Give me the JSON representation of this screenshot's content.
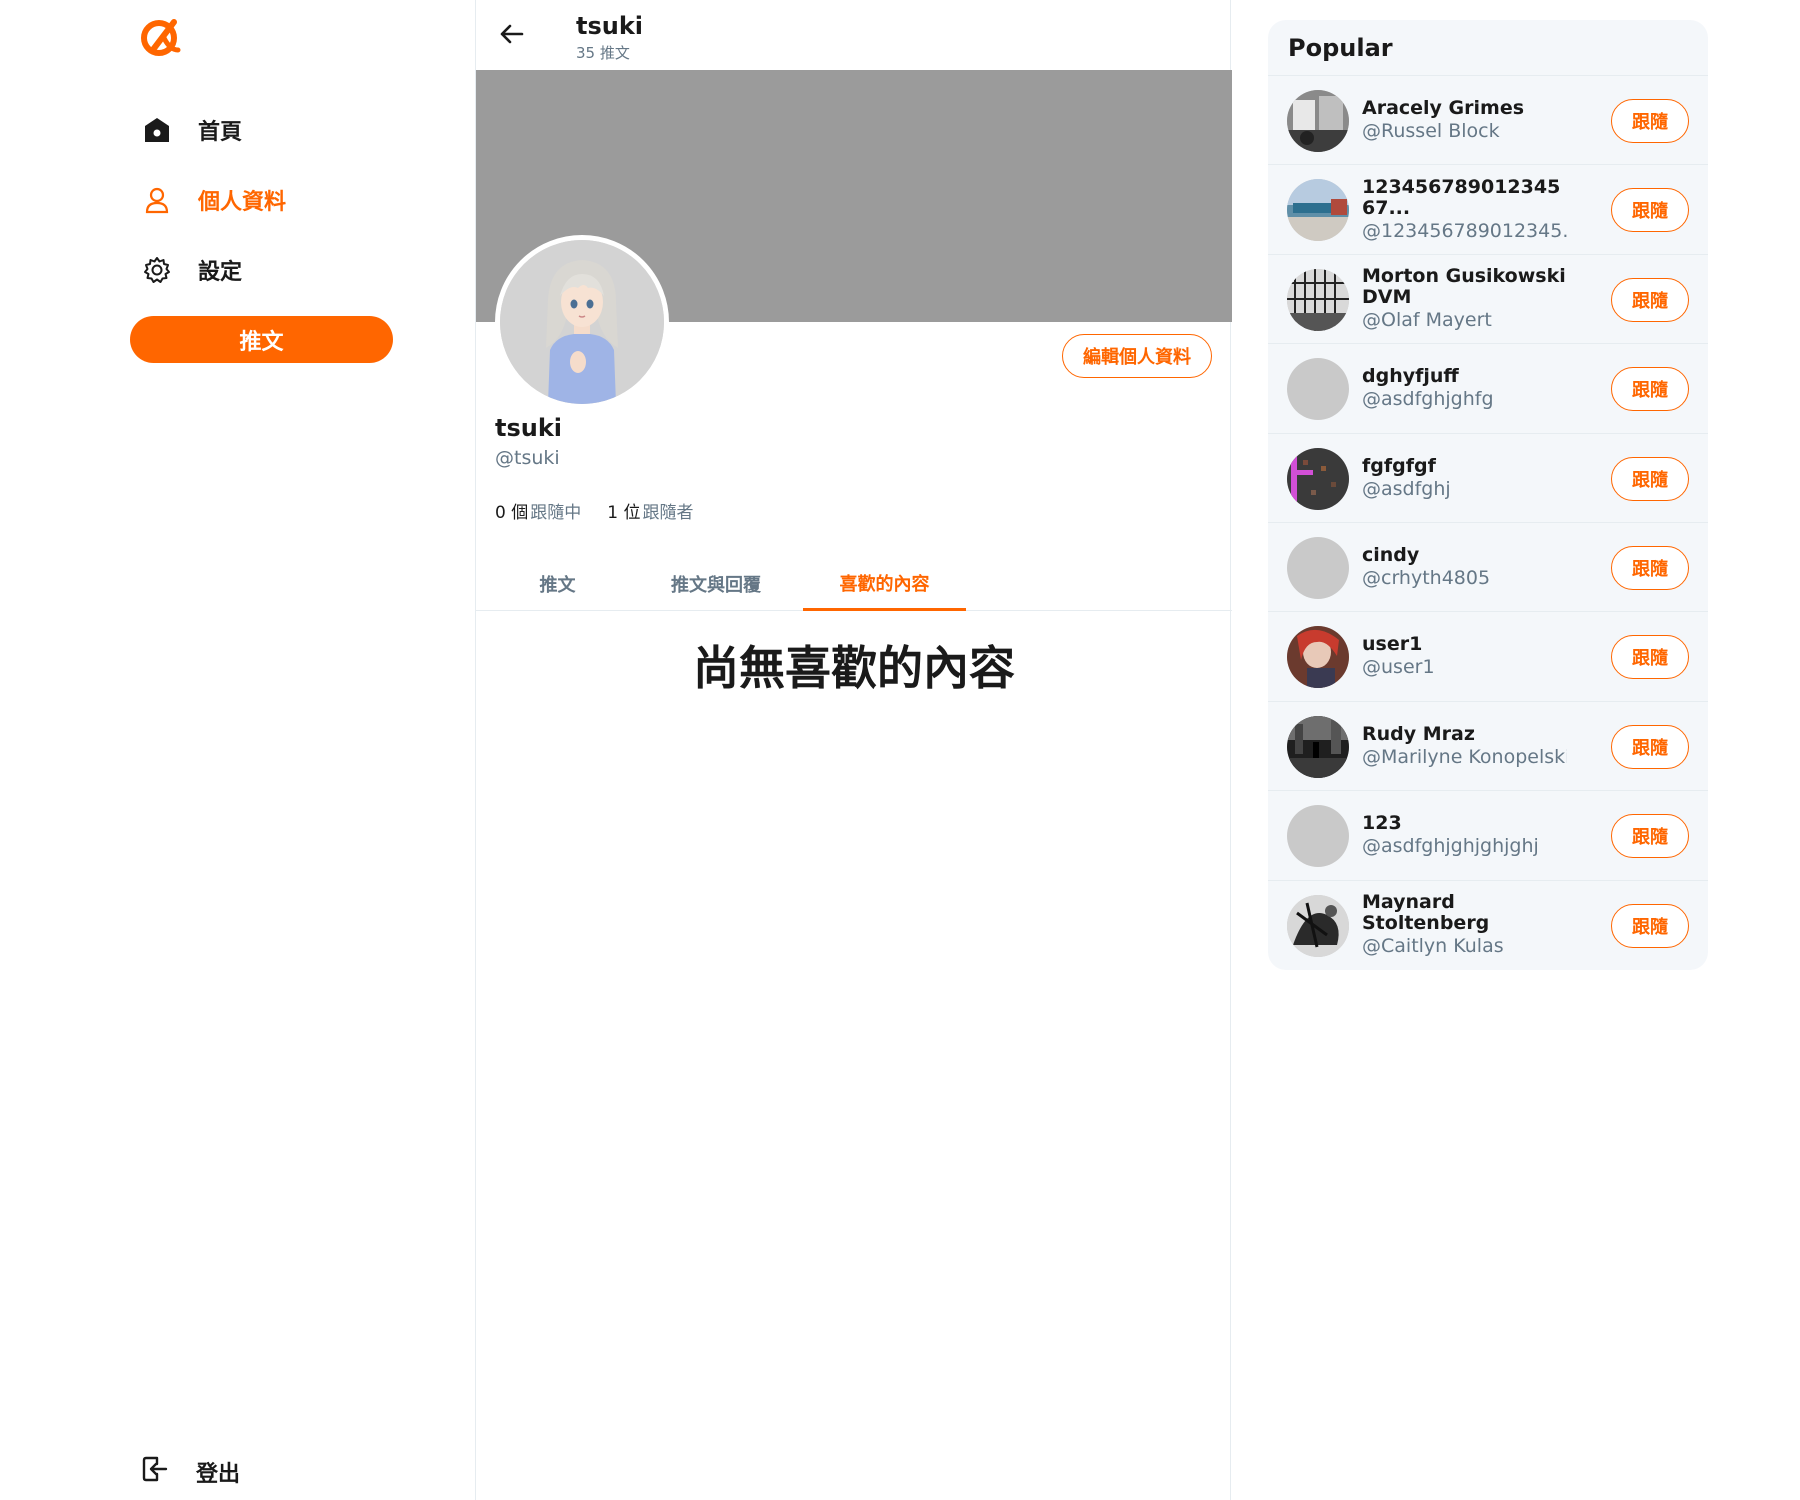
{
  "brand": {
    "accent": "#ff6600",
    "logo_icon": "alpha-logo-icon"
  },
  "sidebar": {
    "items": [
      {
        "label": "首頁",
        "icon": "home-icon"
      },
      {
        "label": "個人資料",
        "icon": "user-icon"
      },
      {
        "label": "設定",
        "icon": "gear-icon"
      }
    ],
    "tweet_button": "推文",
    "logout": "登出"
  },
  "header": {
    "name": "tsuki",
    "tweet_count": "35 推文"
  },
  "profile": {
    "edit_button": "編輯個人資料",
    "name": "tsuki",
    "handle": "@tsuki",
    "following_count": "0 個",
    "following_label": "跟隨中",
    "followers_count": "1 位",
    "followers_label": "跟隨者"
  },
  "tabs": [
    {
      "label": "推文"
    },
    {
      "label": "推文與回覆"
    },
    {
      "label": "喜歡的內容"
    }
  ],
  "empty_message": "尚無喜歡的內容",
  "popular": {
    "title": "Popular",
    "users": [
      {
        "name": "Aracely Grimes",
        "handle": "@Russel Block",
        "follow": "跟隨"
      },
      {
        "name": "12345678901234567...",
        "handle": "@123456789012345...",
        "follow": "跟隨"
      },
      {
        "name": "Morton Gusikowski DVM",
        "handle": "@Olaf Mayert",
        "follow": "跟隨"
      },
      {
        "name": "dghyfjuff",
        "handle": "@asdfghjghfg",
        "follow": "跟隨"
      },
      {
        "name": "fgfgfgf",
        "handle": "@asdfghj",
        "follow": "跟隨"
      },
      {
        "name": "cindy",
        "handle": "@crhyth4805",
        "follow": "跟隨"
      },
      {
        "name": "user1",
        "handle": "@user1",
        "follow": "跟隨"
      },
      {
        "name": "Rudy Mraz",
        "handle": "@Marilyne Konopelski",
        "follow": "跟隨"
      },
      {
        "name": "123",
        "handle": "@asdfghjghjghjghj",
        "follow": "跟隨"
      },
      {
        "name": "Maynard Stoltenberg",
        "handle": "@Caitlyn Kulas",
        "follow": "跟隨"
      }
    ]
  }
}
